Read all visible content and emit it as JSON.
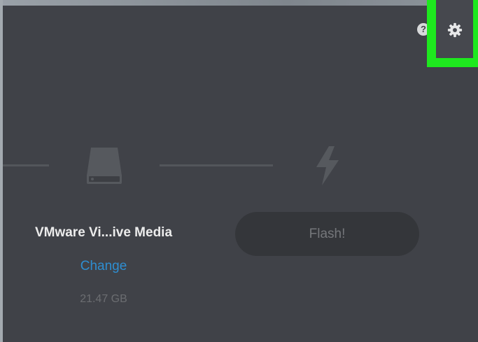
{
  "header": {
    "help_label": "?",
    "help_icon": "question-icon",
    "settings_icon": "gear-icon",
    "highlight_color": "#1ee81e"
  },
  "steps": {
    "drive_icon": "drive-icon",
    "flash_icon": "lightning-icon"
  },
  "drive": {
    "name": "VMware Vi...ive Media",
    "change_label": "Change",
    "size": "21.47 GB"
  },
  "flash": {
    "label": "Flash!"
  },
  "colors": {
    "background": "#404248",
    "link": "#2e8ed1",
    "button": "#34363a"
  }
}
